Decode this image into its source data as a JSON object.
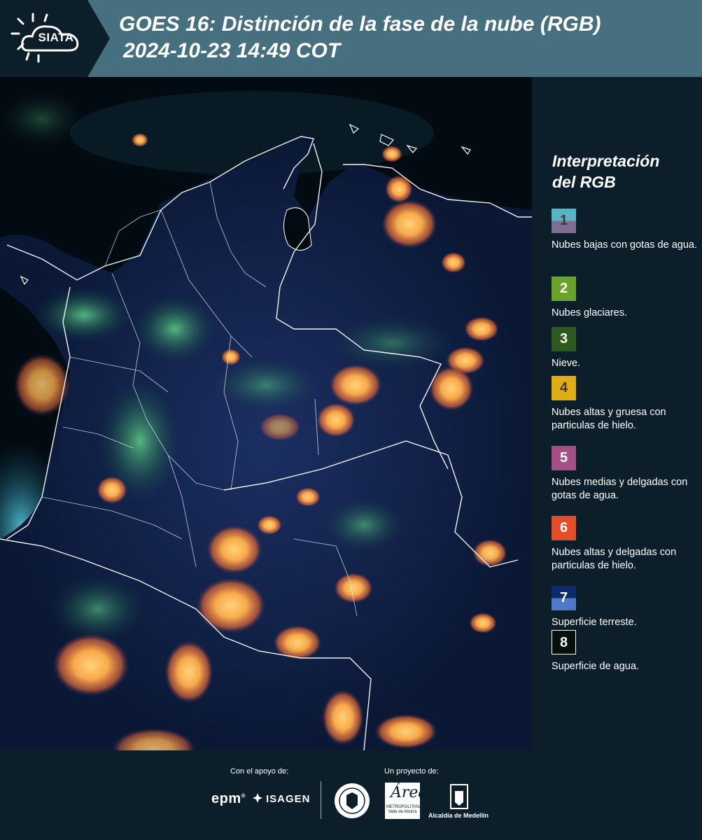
{
  "header": {
    "logo_text": "SIATA",
    "title_line1": "GOES 16: Distinción de la fase de la nube (RGB)",
    "title_line2": "2024-10-23 14:49 COT"
  },
  "legend": {
    "title_line1": "Interpretación",
    "title_line2": "del RGB",
    "items": [
      {
        "number": "1",
        "label": "Nubes bajas con gotas de agua.",
        "color_top": "#5bb3c6",
        "color_bottom": "#7d6f8f",
        "text_color": "#3c3c3c"
      },
      {
        "number": "2",
        "label": "Nubes glaciares.",
        "color_top": "#69a32a",
        "color_bottom": "#69a32a",
        "text_color": "#ffffff"
      },
      {
        "number": "3",
        "label": "Nieve.",
        "color_top": "#2f5a1f",
        "color_bottom": "#2f5a1f",
        "text_color": "#ffffff"
      },
      {
        "number": "4",
        "label": "Nubes altas y gruesa con particulas de hielo.",
        "color_top": "#e2ad12",
        "color_bottom": "#e2ad12",
        "text_color": "#3c3c3c"
      },
      {
        "number": "5",
        "label": "Nubes medias y delgadas con gotas de agua.",
        "color_top": "#a44f86",
        "color_bottom": "#a44f86",
        "text_color": "#ffffff"
      },
      {
        "number": "6",
        "label": "Nubes altas y delgadas con particulas de hielo.",
        "color_top": "#e44c2a",
        "color_bottom": "#e44c2a",
        "text_color": "#ffffff"
      },
      {
        "number": "7",
        "label": "Superficie terreste.",
        "color_top": "#0f2a6b",
        "color_bottom": "#4f78c8",
        "text_color": "#ffffff"
      },
      {
        "number": "8",
        "label": "Superficie de agua.",
        "color_top": "#03100c",
        "color_bottom": "#03100c",
        "text_color": "#ffffff"
      }
    ]
  },
  "footer": {
    "support_label": "Con el apoyo de:",
    "project_label": "Un proyecto de:",
    "epm": "epm",
    "epm_mark": "®",
    "isagen": "ISAGEN",
    "area_script": "Área",
    "area_sub": "METROPOLITANA Valle de Aburrá",
    "alcaldia": "Alcaldía de Medellín"
  },
  "colors": {
    "header_bg": "#46707f",
    "logo_bg": "#0b1e2a",
    "page_bg": "#0b1e2a",
    "cloud_high_thick": "#f4a64a",
    "cloud_glacier": "#3fae6a"
  }
}
